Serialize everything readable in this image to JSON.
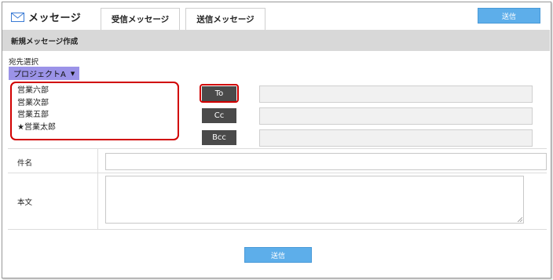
{
  "header": {
    "icon": "envelope-icon",
    "title": "メッセージ",
    "tabs": [
      {
        "label": "受信メッセージ"
      },
      {
        "label": "送信メッセージ"
      }
    ],
    "send_label": "送信"
  },
  "compose": {
    "section_title": "新規メッセージ作成",
    "destination_label": "宛先選択",
    "project_select": {
      "selected": "プロジェクトA"
    },
    "recipients": [
      "営業六部",
      "営業次部",
      "営業五部",
      "★営業太郎"
    ],
    "buttons": {
      "to": "To",
      "cc": "Cc",
      "bcc": "Bcc"
    },
    "to_value": "",
    "cc_value": "",
    "bcc_value": "",
    "subject_label": "件名",
    "subject_value": "",
    "body_label": "本文",
    "body_value": "",
    "send_label": "送信"
  },
  "colors": {
    "accent": "#5daeea",
    "highlight": "#d10000",
    "select_bg": "#9b93e8",
    "dark_button": "#4a4a4a"
  }
}
